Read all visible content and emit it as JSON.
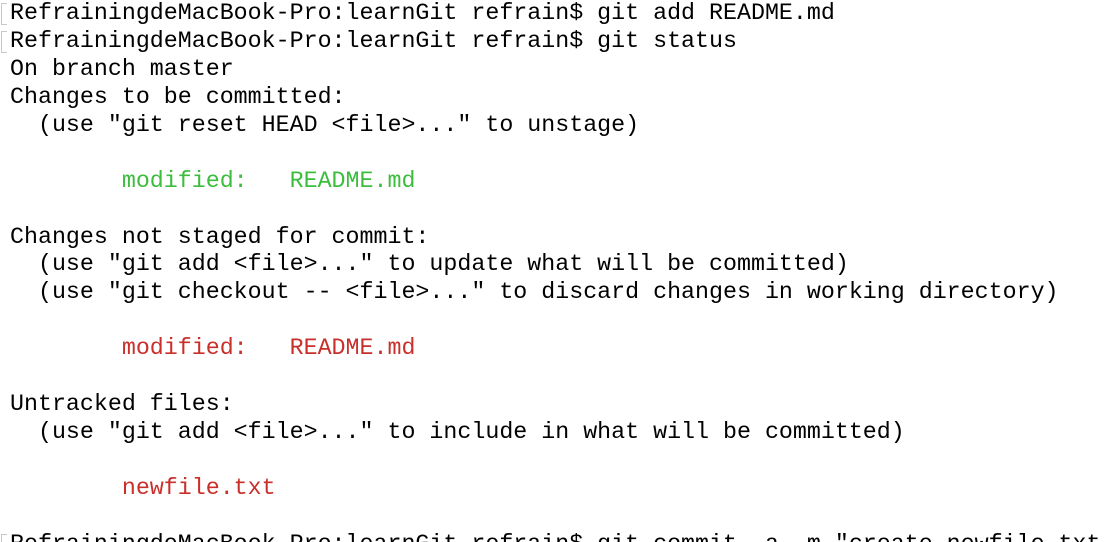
{
  "colors": {
    "staged": "#3dbd3d",
    "unstaged": "#c9302c"
  },
  "lines": [
    {
      "text": "RefrainingdeMacBook-Pro:learnGit refrain$ git add README.md",
      "type": "prompt"
    },
    {
      "text": "RefrainingdeMacBook-Pro:learnGit refrain$ git status",
      "type": "prompt"
    },
    {
      "text": "On branch master",
      "type": "out"
    },
    {
      "text": "Changes to be committed:",
      "type": "out"
    },
    {
      "text": "  (use \"git reset HEAD <file>...\" to unstage)",
      "type": "out"
    },
    {
      "text": "",
      "type": "out"
    },
    {
      "text": "        modified:   README.md",
      "type": "green"
    },
    {
      "text": "",
      "type": "out"
    },
    {
      "text": "Changes not staged for commit:",
      "type": "out"
    },
    {
      "text": "  (use \"git add <file>...\" to update what will be committed)",
      "type": "out"
    },
    {
      "text": "  (use \"git checkout -- <file>...\" to discard changes in working directory)",
      "type": "out"
    },
    {
      "text": "",
      "type": "out"
    },
    {
      "text": "        modified:   README.md",
      "type": "red"
    },
    {
      "text": "",
      "type": "out"
    },
    {
      "text": "Untracked files:",
      "type": "out"
    },
    {
      "text": "  (use \"git add <file>...\" to include in what will be committed)",
      "type": "out"
    },
    {
      "text": "",
      "type": "out"
    },
    {
      "text": "        newfile.txt",
      "type": "red"
    },
    {
      "text": "",
      "type": "out"
    },
    {
      "text": "RefrainingdeMacBook-Pro:learnGit refrain$ git commit -a -m \"create newfile.txt",
      "type": "prompt"
    }
  ]
}
